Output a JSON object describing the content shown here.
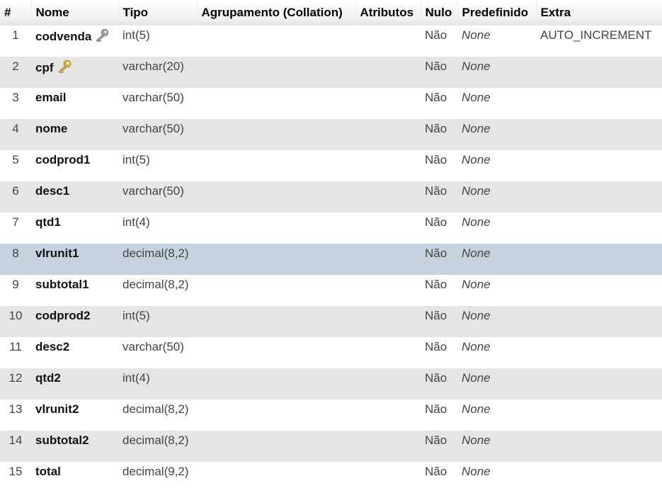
{
  "columns": {
    "num": "#",
    "name": "Nome",
    "type": "Tipo",
    "collation": "Agrupamento (Collation)",
    "attributes": "Atributos",
    "null": "Nulo",
    "default": "Predefinido",
    "extra": "Extra"
  },
  "rows": [
    {
      "num": "1",
      "name": "codvenda",
      "type": "int(5)",
      "collation": "",
      "attributes": "",
      "null": "Não",
      "default": "None",
      "extra": "AUTO_INCREMENT",
      "icon": "primary-key-icon"
    },
    {
      "num": "2",
      "name": "cpf",
      "type": "varchar(20)",
      "collation": "",
      "attributes": "",
      "null": "Não",
      "default": "None",
      "extra": "",
      "icon": "index-key-icon"
    },
    {
      "num": "3",
      "name": "email",
      "type": "varchar(50)",
      "collation": "",
      "attributes": "",
      "null": "Não",
      "default": "None",
      "extra": ""
    },
    {
      "num": "4",
      "name": "nome",
      "type": "varchar(50)",
      "collation": "",
      "attributes": "",
      "null": "Não",
      "default": "None",
      "extra": ""
    },
    {
      "num": "5",
      "name": "codprod1",
      "type": "int(5)",
      "collation": "",
      "attributes": "",
      "null": "Não",
      "default": "None",
      "extra": ""
    },
    {
      "num": "6",
      "name": "desc1",
      "type": "varchar(50)",
      "collation": "",
      "attributes": "",
      "null": "Não",
      "default": "None",
      "extra": ""
    },
    {
      "num": "7",
      "name": "qtd1",
      "type": "int(4)",
      "collation": "",
      "attributes": "",
      "null": "Não",
      "default": "None",
      "extra": ""
    },
    {
      "num": "8",
      "name": "vlrunit1",
      "type": "decimal(8,2)",
      "collation": "",
      "attributes": "",
      "null": "Não",
      "default": "None",
      "extra": ""
    },
    {
      "num": "9",
      "name": "subtotal1",
      "type": "decimal(8,2)",
      "collation": "",
      "attributes": "",
      "null": "Não",
      "default": "None",
      "extra": ""
    },
    {
      "num": "10",
      "name": "codprod2",
      "type": "int(5)",
      "collation": "",
      "attributes": "",
      "null": "Não",
      "default": "None",
      "extra": ""
    },
    {
      "num": "11",
      "name": "desc2",
      "type": "varchar(50)",
      "collation": "",
      "attributes": "",
      "null": "Não",
      "default": "None",
      "extra": ""
    },
    {
      "num": "12",
      "name": "qtd2",
      "type": "int(4)",
      "collation": "",
      "attributes": "",
      "null": "Não",
      "default": "None",
      "extra": ""
    },
    {
      "num": "13",
      "name": "vlrunit2",
      "type": "decimal(8,2)",
      "collation": "",
      "attributes": "",
      "null": "Não",
      "default": "None",
      "extra": ""
    },
    {
      "num": "14",
      "name": "subtotal2",
      "type": "decimal(8,2)",
      "collation": "",
      "attributes": "",
      "null": "Não",
      "default": "None",
      "extra": ""
    },
    {
      "num": "15",
      "name": "total",
      "type": "decimal(9,2)",
      "collation": "",
      "attributes": "",
      "null": "Não",
      "default": "None",
      "extra": ""
    }
  ],
  "colors": {
    "row_odd": "#ffffff",
    "row_even": "#e5e5e5",
    "row_marked": "#c6d2dd",
    "primary_key_icon": "#a0a0a0",
    "index_key_icon": "#e8b820"
  }
}
